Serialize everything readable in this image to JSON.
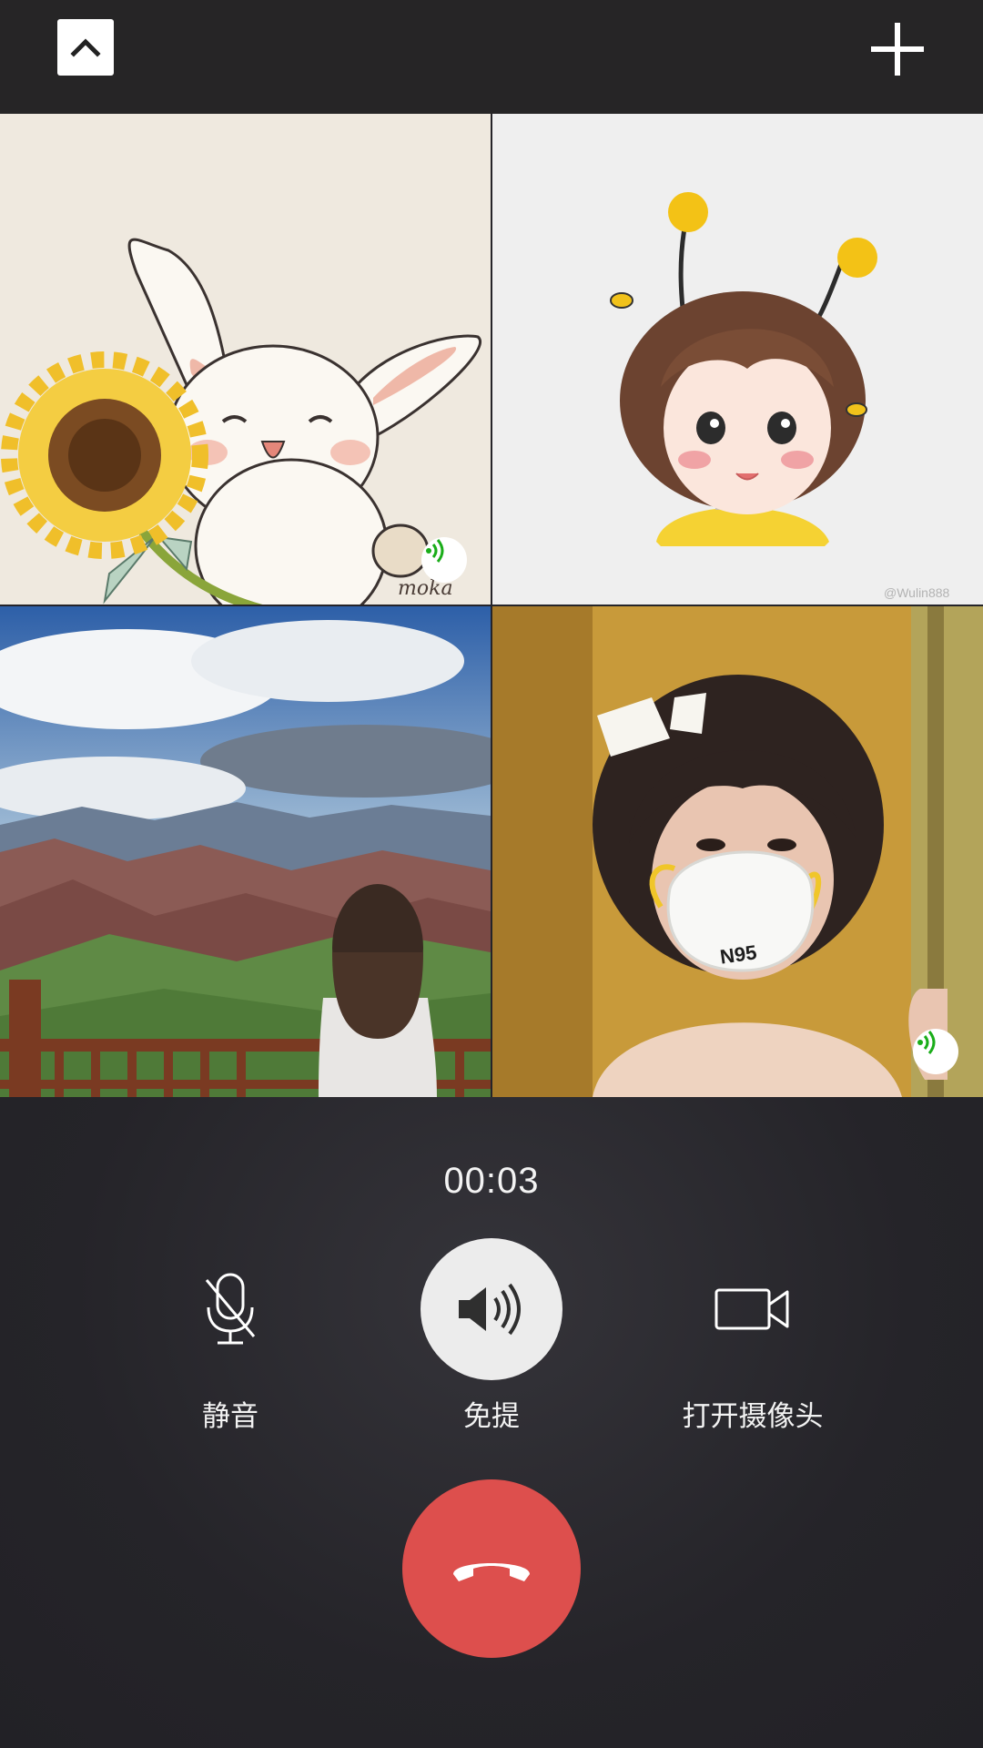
{
  "header": {
    "collapse_icon": "chevron-up-icon",
    "add_icon": "plus-icon"
  },
  "participants": [
    {
      "avatar": "bunny-with-sunflower",
      "signature_text": "moka",
      "speaking": true
    },
    {
      "avatar": "girl-with-bee-antennae",
      "watermark_text": "@Wulin888",
      "speaking": false
    },
    {
      "avatar": "woman-at-mountain-overlook",
      "speaking": false
    },
    {
      "avatar": "girl-with-n95-mask",
      "mask_text": "N95",
      "speaking": true
    }
  ],
  "call": {
    "timer": "00:03"
  },
  "controls": {
    "mute_label": "静音",
    "speaker_label": "免提",
    "camera_label": "打开摄像头",
    "mute_icon": "microphone-off-icon",
    "speaker_icon": "speaker-icon",
    "camera_icon": "video-camera-icon",
    "hangup_icon": "phone-hangup-icon"
  },
  "colors": {
    "background": "#252429",
    "hangup": "#dd4f4d",
    "speaker_active": "#ececec",
    "speaking_indicator": "#1aad19"
  }
}
